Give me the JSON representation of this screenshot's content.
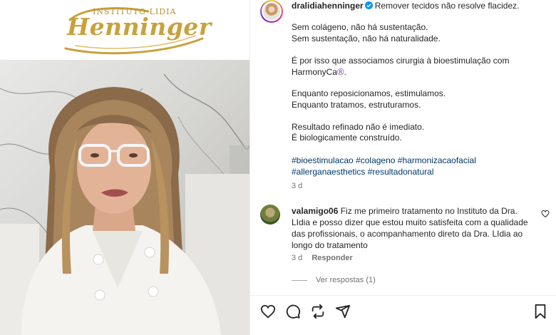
{
  "media": {
    "brand": {
      "subtitle": "INSTITUTO LIDIA",
      "name": "Henninger"
    }
  },
  "post": {
    "username": "dralidiahenninger",
    "caption_first": "Remover tecidos não resolve flacidez.",
    "caption_lines": [
      "Sem colágeno, não há sustentação.",
      "Sem sustentação, não há naturalidade.",
      "",
      "É por isso que associamos cirurgia à bioestimulação com",
      "HarmonyCa",
      "",
      "Enquanto reposicionamos, estimulamos.",
      "Enquanto tratamos, estruturamos.",
      "",
      "Resultado refinado não é imediato.",
      "É biologicamente construído."
    ],
    "registered_mark": "®",
    "caption_trailing": ".",
    "hashtags": [
      "#bioestimulacao",
      "#colageno",
      "#harmonizacaofacial",
      "#allerganaesthetics",
      "#resultadonatural"
    ],
    "time": "3 d"
  },
  "comment": {
    "username": "valamigo06",
    "text": "Fiz me primeiro tratamento no Instituto da Dra. LIdia e posso dizer que estou muito satisfeita com a qualidade das profissionais, o acompanhamento direto da Dra. LIdia ao longo do tratamento",
    "time": "3 d",
    "reply_label": "Responder",
    "view_replies": "Ver respostas (1)"
  },
  "colors": {
    "gold": "#c9a13c",
    "hashtag": "#00376b",
    "muted": "#737373",
    "verified": "#0095f6"
  },
  "icons": [
    "heart-icon",
    "comment-icon",
    "repost-icon",
    "share-icon",
    "bookmark-icon",
    "verified-icon"
  ]
}
